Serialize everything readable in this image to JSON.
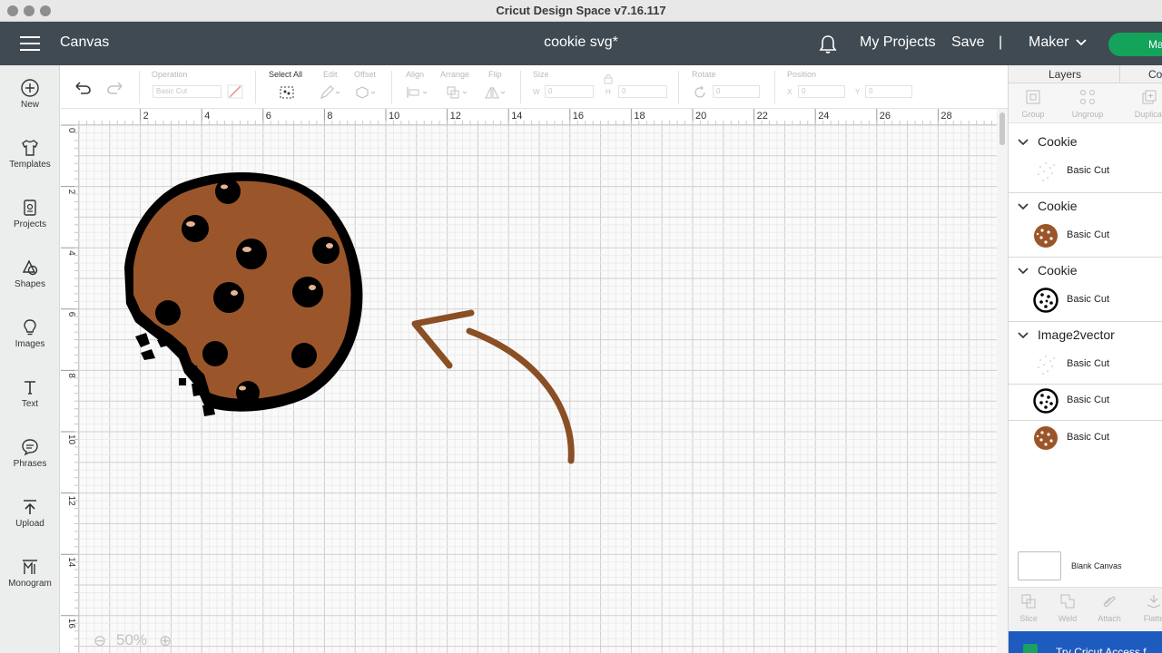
{
  "window": {
    "title": "Cricut Design Space  v7.16.117"
  },
  "header": {
    "canvas_label": "Canvas",
    "project_name": "cookie svg*",
    "my_projects": "My Projects",
    "save": "Save",
    "separator": "|",
    "machine": "Maker",
    "make_button": "Ma"
  },
  "sidebar": {
    "items": [
      {
        "label": "New",
        "icon": "plus-circle-icon"
      },
      {
        "label": "Templates",
        "icon": "shirt-icon"
      },
      {
        "label": "Projects",
        "icon": "projects-icon"
      },
      {
        "label": "Shapes",
        "icon": "shapes-icon"
      },
      {
        "label": "Images",
        "icon": "lightbulb-icon"
      },
      {
        "label": "Text",
        "icon": "text-icon"
      },
      {
        "label": "Phrases",
        "icon": "speech-bubble-icon"
      },
      {
        "label": "Upload",
        "icon": "upload-icon"
      },
      {
        "label": "Monogram",
        "icon": "monogram-icon"
      }
    ]
  },
  "toolbar": {
    "operation_label": "Operation",
    "operation_value": "Basic Cut",
    "select_all": "Select All",
    "edit": "Edit",
    "offset": "Offset",
    "align": "Align",
    "arrange": "Arrange",
    "flip": "Flip",
    "size": "Size",
    "w_label": "W",
    "w_value": "0",
    "h_label": "H",
    "h_value": "0",
    "rotate": "Rotate",
    "rotate_value": "0",
    "position": "Position",
    "x_label": "X",
    "x_value": "0",
    "y_label": "Y",
    "y_value": "0"
  },
  "canvas": {
    "ruler_top": [
      "2",
      "4",
      "6",
      "8",
      "10",
      "12",
      "14",
      "16",
      "18",
      "20",
      "22",
      "24",
      "26",
      "28"
    ],
    "ruler_left": [
      "0",
      "2",
      "4",
      "6",
      "8",
      "10",
      "12",
      "14",
      "16"
    ],
    "zoom": "50%",
    "colors": {
      "cookie": "#9a562a",
      "arrow": "#8a4f24",
      "outline": "#000000"
    }
  },
  "layers_panel": {
    "tabs": [
      "Layers",
      "Co"
    ],
    "tools": [
      "Group",
      "Ungroup",
      "Duplicat"
    ],
    "groups": [
      {
        "name": "Cookie",
        "items": [
          {
            "label": "Basic Cut",
            "thumb": "dots"
          }
        ]
      },
      {
        "name": "Cookie",
        "items": [
          {
            "label": "Basic Cut",
            "thumb": "brown"
          }
        ]
      },
      {
        "name": "Cookie",
        "items": [
          {
            "label": "Basic Cut",
            "thumb": "outline"
          }
        ]
      },
      {
        "name": "Image2vector",
        "items": [
          {
            "label": "Basic Cut",
            "thumb": "dots"
          },
          {
            "label": "Basic Cut",
            "thumb": "outline"
          },
          {
            "label": "Basic Cut",
            "thumb": "brown"
          }
        ]
      }
    ],
    "blank_canvas": "Blank Canvas",
    "bottom_tools": [
      "Slice",
      "Weld",
      "Attach",
      "Flatte"
    ],
    "banner": "Try Cricut Access f"
  }
}
